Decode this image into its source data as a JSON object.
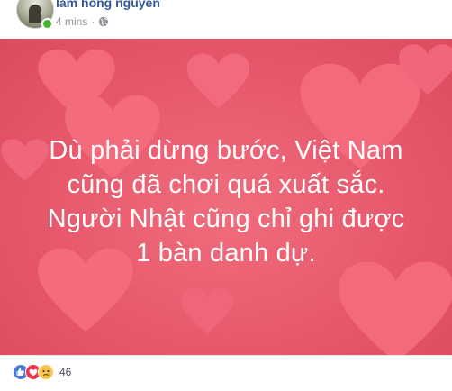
{
  "post": {
    "author": "lam hong nguyen",
    "timestamp": "4 mins",
    "separator": "·",
    "privacy_icon": "globe-icon"
  },
  "image": {
    "caption_lines": [
      "Dù phải dừng bước, Việt Nam",
      "cũng đã chơi quá xuất sắc.",
      "Người Nhật cũng chỉ ghi được",
      "1 bàn danh dự."
    ],
    "background_color": "#e8586c",
    "heart_color": "#f5667a"
  },
  "reactions": {
    "types": [
      "like-icon",
      "love-icon",
      "sad-icon"
    ],
    "count": "46"
  }
}
